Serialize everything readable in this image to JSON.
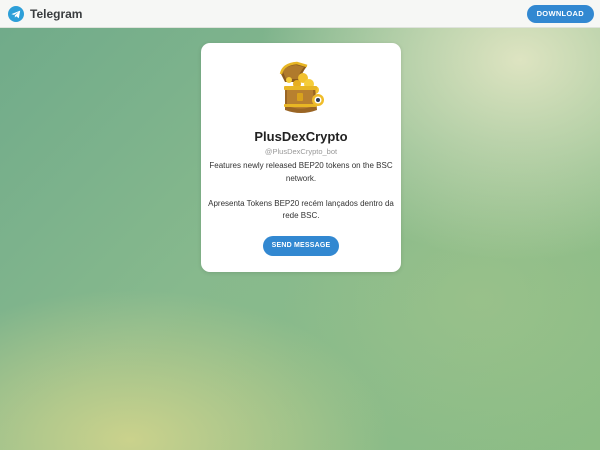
{
  "header": {
    "brand": "Telegram",
    "download_label": "DOWNLOAD",
    "logo_icon": "telegram-logo-icon"
  },
  "profile": {
    "avatar_icon": "treasure-chest-icon",
    "name": "PlusDexCrypto",
    "username": "@PlusDexCrypto_bot",
    "description_en": "Features newly released BEP20 tokens on the BSC network.",
    "description_pt": "Apresenta Tokens BEP20 recém lançados dentro da rede BSC.",
    "send_label": "SEND MESSAGE"
  },
  "colors": {
    "accent": "#3288d1",
    "logo": "#2d9fd8"
  }
}
